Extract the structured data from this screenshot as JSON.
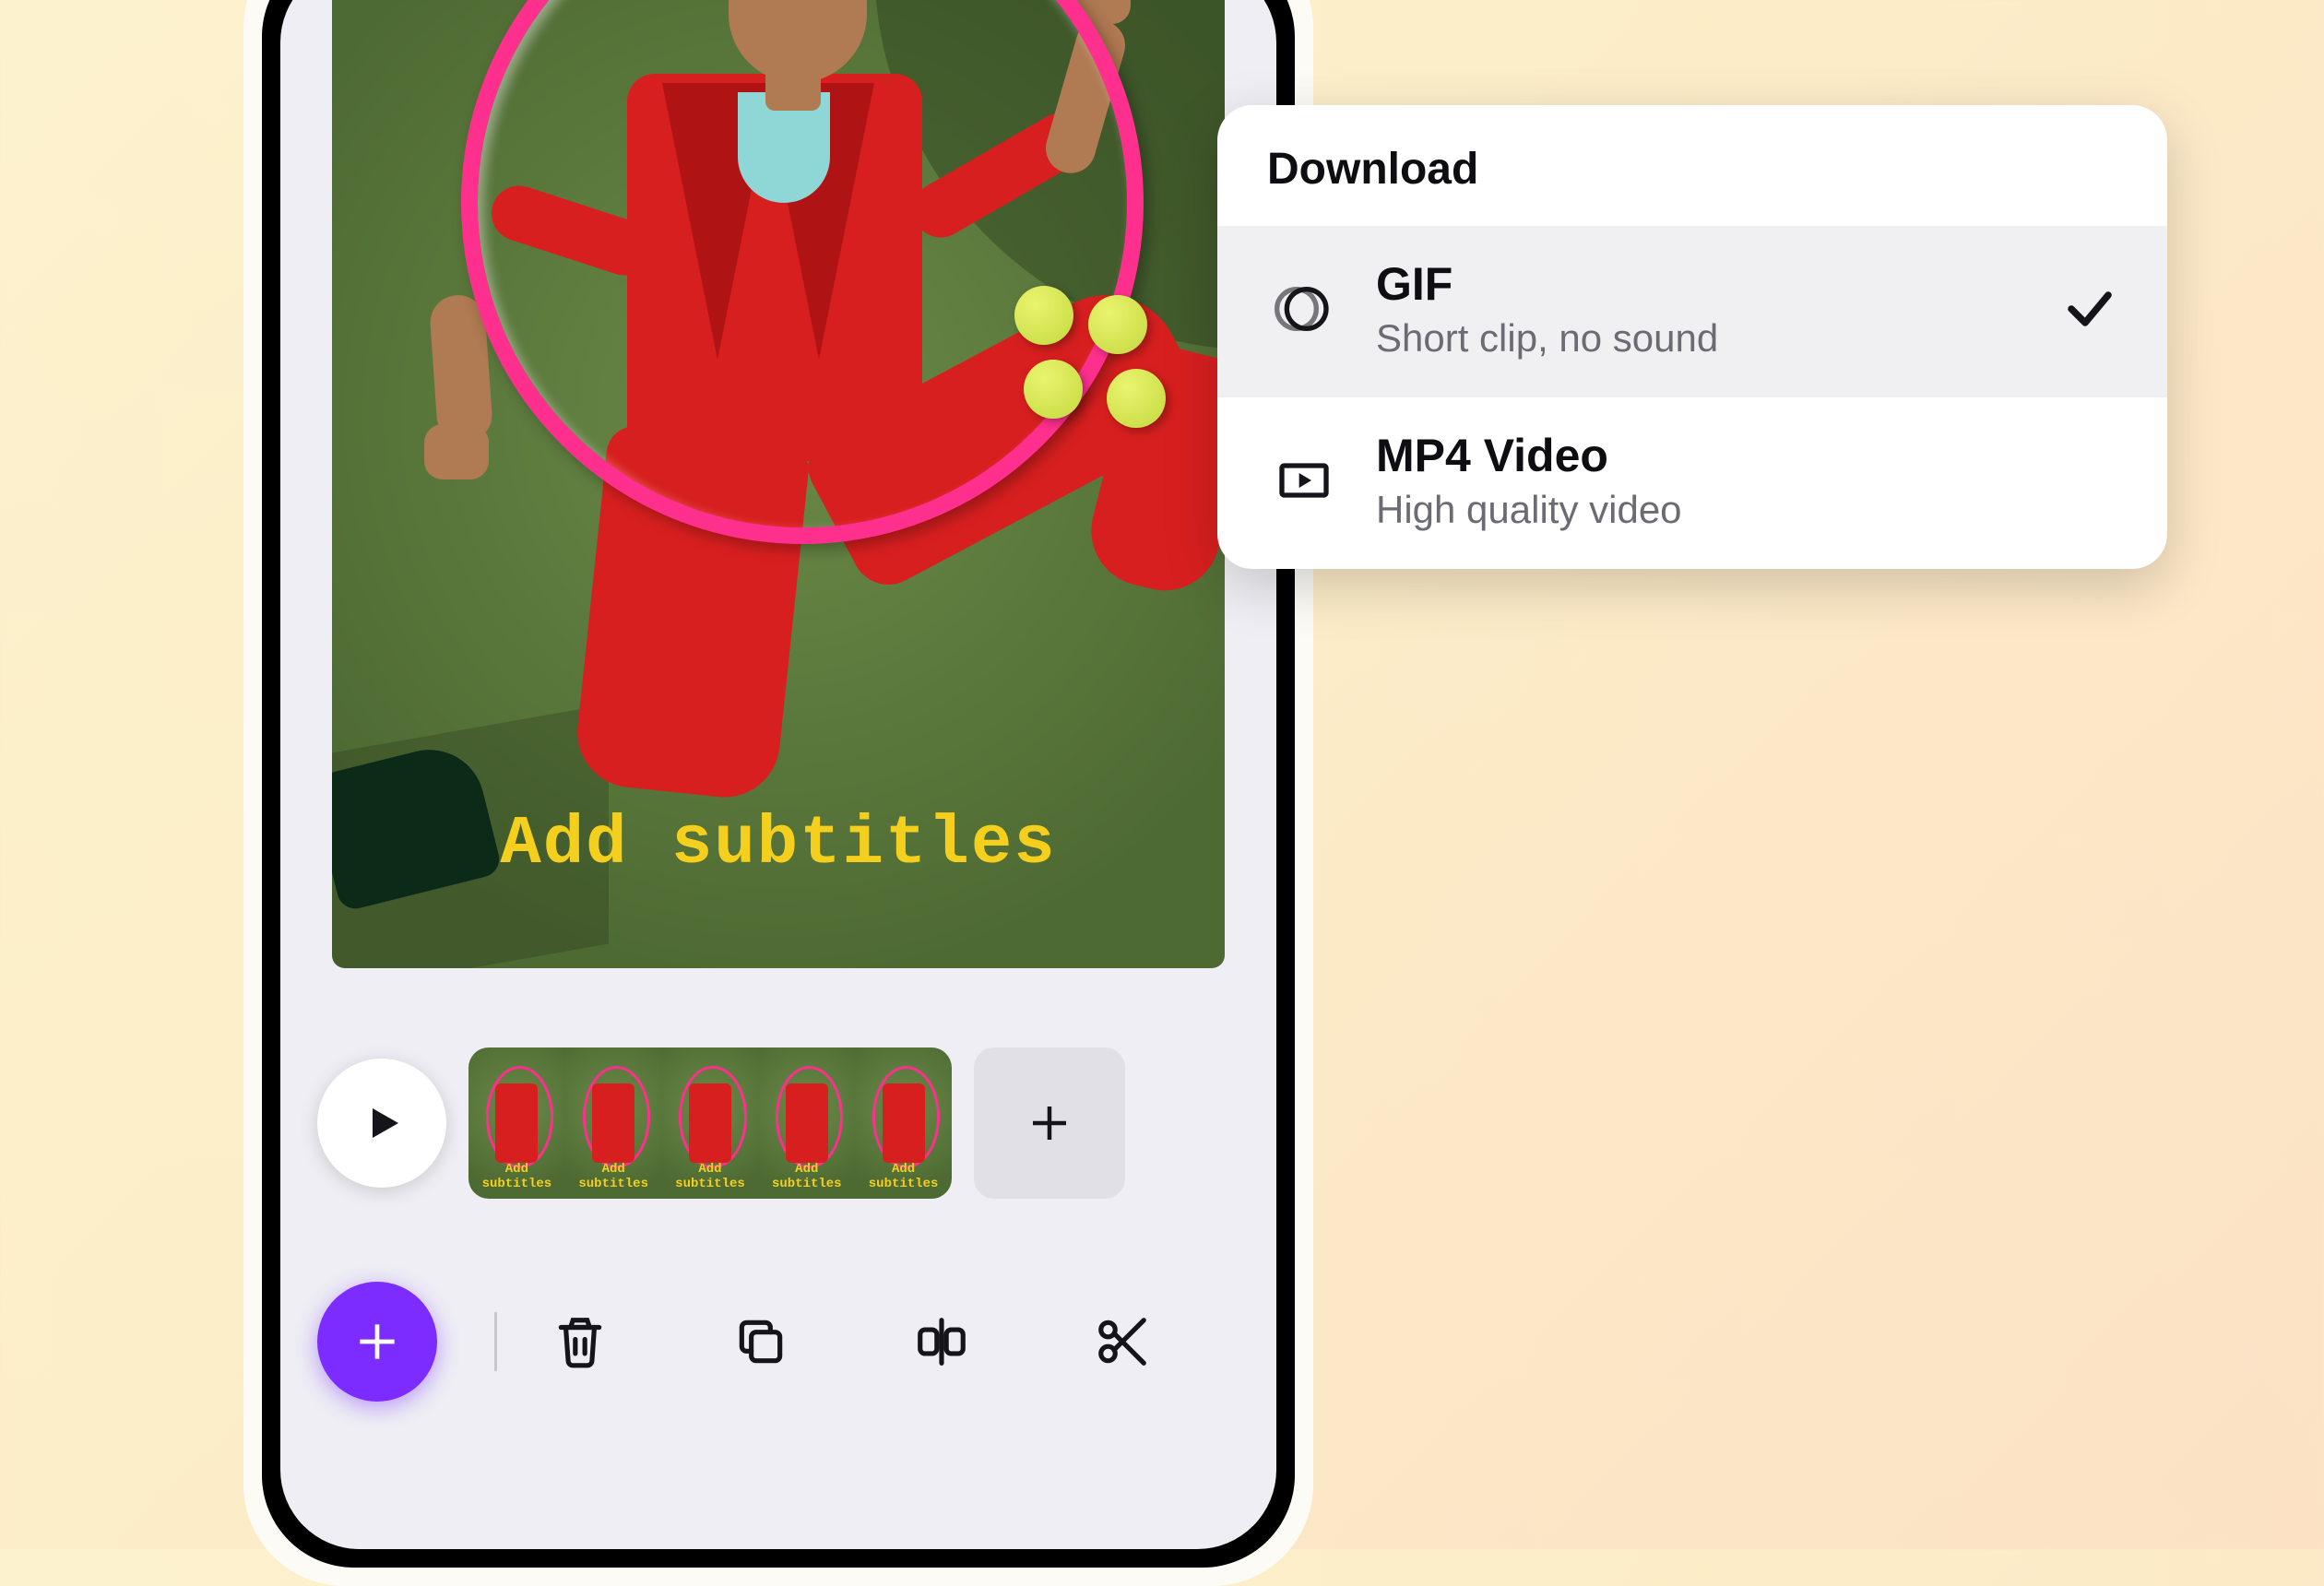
{
  "editor": {
    "subtitle_overlay": "Add subtitles",
    "thumbnail_label": "Add subtitles",
    "colors": {
      "subject_outfit": "#d81f1f",
      "hoop": "#ff2f8e",
      "grass": "#5b7a3a",
      "subtitle_text": "#f5cf1e",
      "fab": "#7c2cff"
    },
    "timeline": {
      "thumbnail_count": 5
    },
    "toolbar": {
      "play": "Play",
      "add_clip": "Add clip",
      "fab": "Add",
      "delete": "Delete",
      "duplicate": "Duplicate",
      "split": "Split",
      "cut": "Cut"
    }
  },
  "download_popover": {
    "title": "Download",
    "options": [
      {
        "icon": "gif-icon",
        "title": "GIF",
        "subtitle": "Short clip, no sound",
        "selected": true
      },
      {
        "icon": "mp4-icon",
        "title": "MP4 Video",
        "subtitle": "High quality video",
        "selected": false
      }
    ]
  }
}
